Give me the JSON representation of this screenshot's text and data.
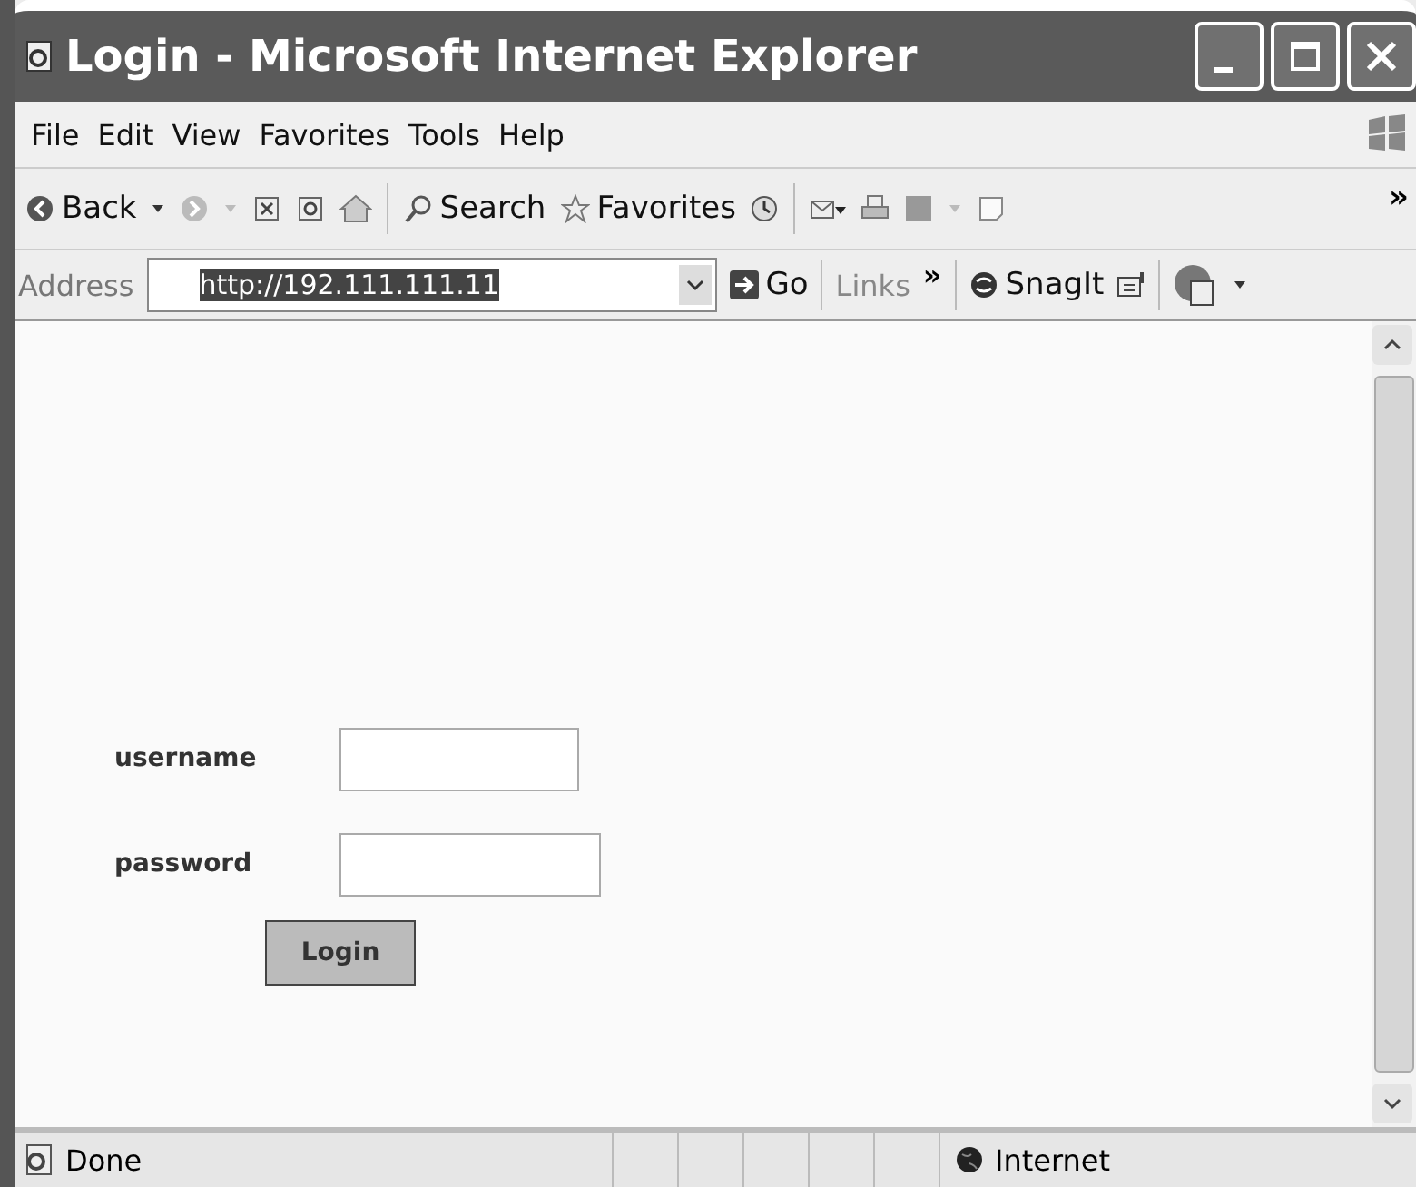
{
  "window": {
    "title": "Login - Microsoft Internet Explorer"
  },
  "menu": [
    "File",
    "Edit",
    "View",
    "Favorites",
    "Tools",
    "Help"
  ],
  "toolbar": {
    "back": "Back",
    "search": "Search",
    "favorites": "Favorites",
    "more": "»"
  },
  "address_bar": {
    "label": "Address",
    "value": "http://192.111.111.11",
    "go": "Go",
    "links": "Links",
    "more": "»",
    "snagit": "SnagIt"
  },
  "form": {
    "fields": [
      {
        "label": "username"
      },
      {
        "label": "password"
      }
    ],
    "button": "Login"
  },
  "status_bar": {
    "text": "Done",
    "zone": "Internet"
  }
}
